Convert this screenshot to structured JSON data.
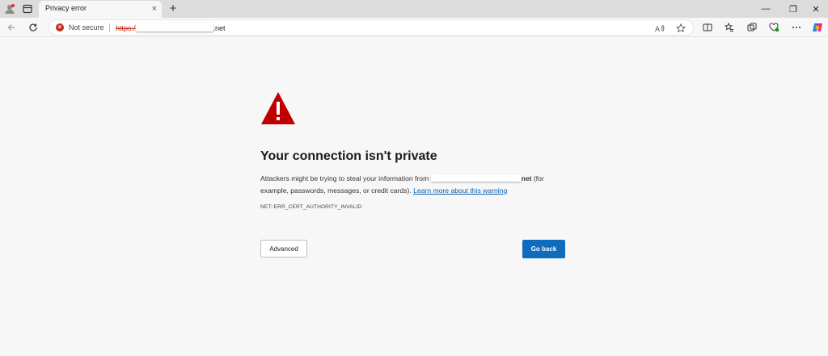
{
  "tab": {
    "title": "Privacy error",
    "close": "×"
  },
  "newtab": "+",
  "window_controls": {
    "minimize": "—",
    "restore": "❐",
    "close": "✕"
  },
  "addressbar": {
    "security_label": "Not secure",
    "url_scheme": "https:/",
    "url_suffix": ".net"
  },
  "icons": {
    "profile": "profile-icon",
    "tab_actions": "tab-actions-icon",
    "back": "back-icon",
    "refresh": "refresh-icon",
    "read_aloud": "read-aloud-icon",
    "favorite": "star-icon",
    "split": "split-screen-icon",
    "favorites": "favorites-icon",
    "collections": "collections-icon",
    "browser_essentials": "heart-icon",
    "more": "more-icon",
    "copilot": "copilot-icon"
  },
  "page": {
    "heading": "Your connection isn't private",
    "body_before": "Attackers might be trying to steal your information from ",
    "body_domain_end": "net",
    "body_after": " (for example, passwords, messages, or credit cards). ",
    "learn_more": "Learn more about this warning",
    "error_code": "NET::ERR_CERT_AUTHORITY_INVALID",
    "advanced": "Advanced",
    "go_back": "Go back"
  },
  "colors": {
    "warning": "#c00000",
    "primary": "#0f6cbd",
    "link": "#0a5fb3"
  }
}
